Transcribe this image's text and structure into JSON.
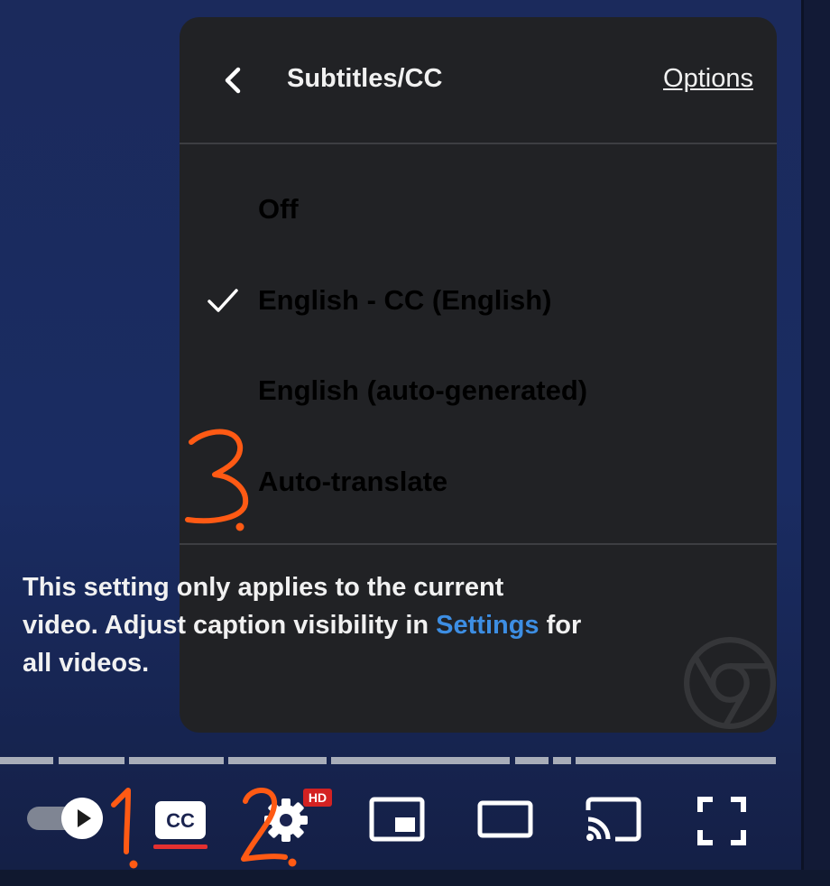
{
  "menu": {
    "title": "Subtitles/CC",
    "options_label": "Options",
    "back_icon": "chevron-left-icon",
    "items": [
      {
        "label": "Off",
        "selected": false
      },
      {
        "label": "English - CC (English)",
        "selected": true
      },
      {
        "label": "English (auto-generated)",
        "selected": false
      },
      {
        "label": "Auto-translate",
        "selected": false
      }
    ],
    "note": {
      "before": "This setting only applies to the current video. Adjust caption visibility in ",
      "link": "Settings",
      "after": " for all videos."
    }
  },
  "player": {
    "hd_badge": "HD",
    "icons": [
      "autoplay-toggle-icon",
      "closed-captions-icon",
      "settings-gear-icon",
      "miniplayer-icon",
      "theater-mode-icon",
      "cast-icon",
      "fullscreen-icon"
    ]
  },
  "annotations": {
    "marks": [
      "1.",
      "2.",
      "3."
    ]
  },
  "colors": {
    "panel_bg": "#212225",
    "link": "#3d8ee3",
    "annotation": "#ff5a14",
    "hd_badge": "#d32222",
    "cc_active": "#e33030"
  }
}
